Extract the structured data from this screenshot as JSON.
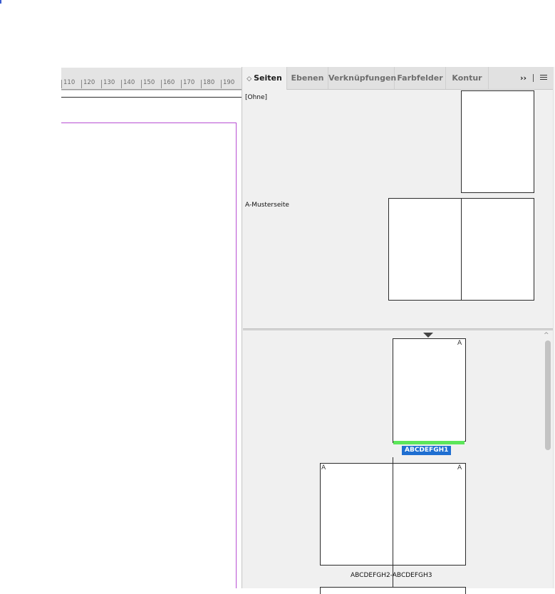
{
  "ruler": {
    "ticks": [
      "110",
      "120",
      "130",
      "140",
      "150",
      "160",
      "170",
      "180",
      "190"
    ]
  },
  "panel": {
    "tabs": [
      {
        "label": "Seiten",
        "active": true
      },
      {
        "label": "Ebenen",
        "active": false
      },
      {
        "label": "Verknüpfungen",
        "active": false
      },
      {
        "label": "Farbfelder",
        "active": false
      },
      {
        "label": "Kontur",
        "active": false
      }
    ],
    "more_label": "››",
    "masters": [
      {
        "label": "[Ohne]"
      },
      {
        "label": "A-Musterseite"
      }
    ],
    "pages": {
      "page1": {
        "master_letter": "A",
        "label": "ABCDEFGH1"
      },
      "spread": {
        "left_letter": "A",
        "right_letter": "A",
        "label": "ABCDEFGH2-ABCDEFGH3"
      }
    },
    "colors": {
      "selection": "#1f6fd1",
      "current_page_bar": "#5ce65a",
      "margin": "#b84fd3"
    }
  }
}
